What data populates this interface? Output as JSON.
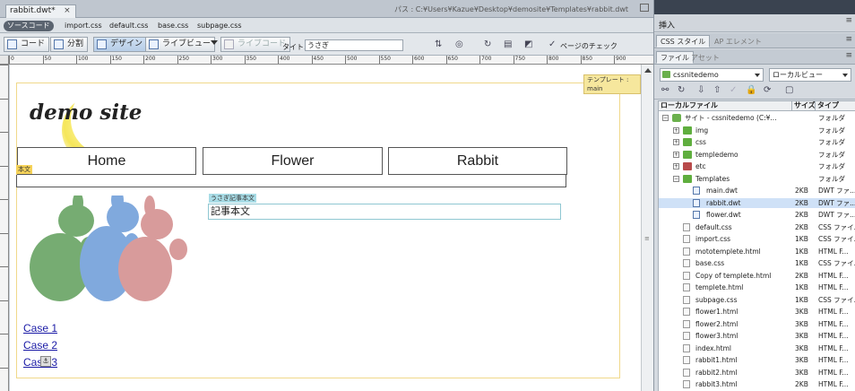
{
  "document": {
    "tab_label": "rabbit.dwt*",
    "tab_close": "×",
    "path": "パス : C:¥Users¥Kazue¥Desktop¥demosite¥Templates¥rabbit.dwt"
  },
  "related_files": {
    "source_button": "ソースコード",
    "files": [
      "import.css",
      "default.css",
      "base.css",
      "subpage.css"
    ]
  },
  "toolbar": {
    "code": "コード",
    "split": "分割",
    "design": "デザイン",
    "live_view": "ライブビュー",
    "live_code": "ライブコード",
    "title_label": "タイトル :",
    "title_value": "うさぎ",
    "check_page": "ページのチェック"
  },
  "ruler": {
    "ticks": [
      "0",
      "50",
      "100",
      "150",
      "200",
      "250",
      "300",
      "350",
      "400",
      "450",
      "500",
      "550",
      "600",
      "650",
      "700",
      "750",
      "800",
      "850",
      "900"
    ]
  },
  "canvas": {
    "template_tag": "テンプレート : main",
    "logo_text": "demo site",
    "nav": [
      "Home",
      "Flower",
      "Rabbit"
    ],
    "body_tag": "本文",
    "article_tag": "うさぎ記事本文",
    "article_text": "記事本文",
    "cases": [
      "Case 1",
      "Case 2",
      "Case 3"
    ],
    "anchor_symbol": "⚓"
  },
  "panels": {
    "insert": "挿入",
    "css_tabs": [
      "CSS スタイル",
      "AP エレメント"
    ],
    "file_tabs": [
      "ファイル",
      "アセット"
    ],
    "site_select": "cssnitedemo",
    "view_select": "ローカルビュー",
    "headers": {
      "local": "ローカルファイル",
      "size": "サイズ",
      "type": "タイプ"
    },
    "files": [
      {
        "name": "サイト - cssnitedemo (C:¥...",
        "size": "",
        "type": "フォルダ",
        "kind": "site",
        "level": 0,
        "exp": "−"
      },
      {
        "name": "img",
        "size": "",
        "type": "フォルダ",
        "kind": "folder",
        "level": 1,
        "exp": "+"
      },
      {
        "name": "css",
        "size": "",
        "type": "フォルダ",
        "kind": "folder",
        "level": 1,
        "exp": "+"
      },
      {
        "name": "templedemo",
        "size": "",
        "type": "フォルダ",
        "kind": "folder",
        "level": 1,
        "exp": "+"
      },
      {
        "name": "etc",
        "size": "",
        "type": "フォルダ",
        "kind": "etc",
        "level": 1,
        "exp": "+"
      },
      {
        "name": "Templates",
        "size": "",
        "type": "フォルダ",
        "kind": "folder",
        "level": 1,
        "exp": "−"
      },
      {
        "name": "main.dwt",
        "size": "2KB",
        "type": "DWT ファ...",
        "kind": "dwt",
        "level": 2,
        "exp": ""
      },
      {
        "name": "rabbit.dwt",
        "size": "2KB",
        "type": "DWT ファ...",
        "kind": "dwt",
        "level": 2,
        "exp": ""
      },
      {
        "name": "flower.dwt",
        "size": "2KB",
        "type": "DWT ファ...",
        "kind": "dwt",
        "level": 2,
        "exp": ""
      },
      {
        "name": "default.css",
        "size": "2KB",
        "type": "CSS ファイ...",
        "kind": "file",
        "level": 1,
        "exp": ""
      },
      {
        "name": "import.css",
        "size": "1KB",
        "type": "CSS ファイ...",
        "kind": "file",
        "level": 1,
        "exp": ""
      },
      {
        "name": "mototemplete.html",
        "size": "1KB",
        "type": "HTML F...",
        "kind": "file",
        "level": 1,
        "exp": ""
      },
      {
        "name": "base.css",
        "size": "1KB",
        "type": "CSS ファイ...",
        "kind": "file",
        "level": 1,
        "exp": ""
      },
      {
        "name": "Copy of templete.html",
        "size": "2KB",
        "type": "HTML F...",
        "kind": "file",
        "level": 1,
        "exp": ""
      },
      {
        "name": "templete.html",
        "size": "1KB",
        "type": "HTML F...",
        "kind": "file",
        "level": 1,
        "exp": ""
      },
      {
        "name": "subpage.css",
        "size": "1KB",
        "type": "CSS ファイ...",
        "kind": "file",
        "level": 1,
        "exp": ""
      },
      {
        "name": "flower1.html",
        "size": "3KB",
        "type": "HTML F...",
        "kind": "file",
        "level": 1,
        "exp": ""
      },
      {
        "name": "flower2.html",
        "size": "3KB",
        "type": "HTML F...",
        "kind": "file",
        "level": 1,
        "exp": ""
      },
      {
        "name": "flower3.html",
        "size": "3KB",
        "type": "HTML F...",
        "kind": "file",
        "level": 1,
        "exp": ""
      },
      {
        "name": "index.html",
        "size": "3KB",
        "type": "HTML F...",
        "kind": "file",
        "level": 1,
        "exp": ""
      },
      {
        "name": "rabbit1.html",
        "size": "3KB",
        "type": "HTML F...",
        "kind": "file",
        "level": 1,
        "exp": ""
      },
      {
        "name": "rabbit2.html",
        "size": "3KB",
        "type": "HTML F...",
        "kind": "file",
        "level": 1,
        "exp": ""
      },
      {
        "name": "rabbit3.html",
        "size": "2KB",
        "type": "HTML F...",
        "kind": "file",
        "level": 1,
        "exp": ""
      }
    ]
  },
  "colors": {
    "accent_link": "#1a1aa6",
    "template_tag": "#f6e79d",
    "article_tag": "#a8dce6",
    "rabbit_green": "#5f9e5a",
    "rabbit_blue": "#6b9bd8",
    "rabbit_red": "#d28a8a"
  }
}
